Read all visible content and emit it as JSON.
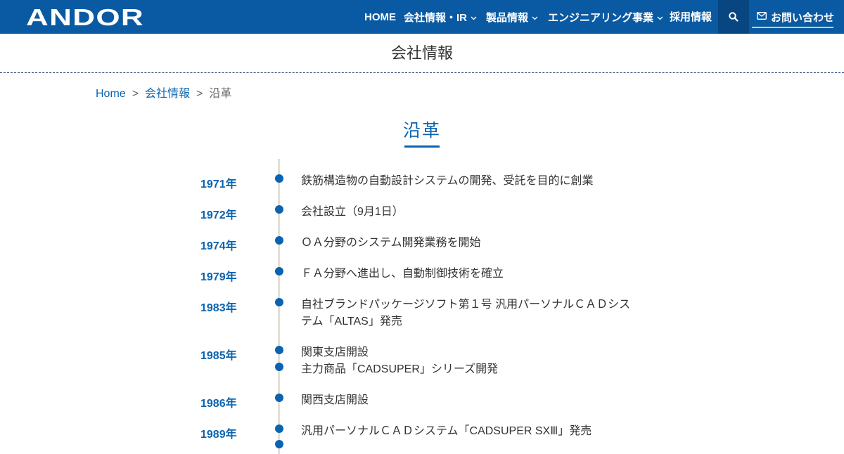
{
  "header": {
    "logo_text": "ANDOR",
    "nav": [
      {
        "label": "HOME",
        "has_dropdown": false
      },
      {
        "label": "会社情報・IR",
        "has_dropdown": true
      },
      {
        "label": "製品情報",
        "has_dropdown": true
      },
      {
        "label": "エンジニアリング事業",
        "has_dropdown": true
      },
      {
        "label": "採用情報",
        "has_dropdown": false
      }
    ],
    "search_icon": "search-icon",
    "contact_label": "お問い合わせ",
    "contact_icon": "mail-icon",
    "colors": {
      "bar": "#0a5aa3",
      "search_bg": "#074680",
      "accent_underline": "#e8d07a"
    }
  },
  "page_title": "会社情報",
  "breadcrumb": [
    {
      "label": "Home",
      "link": true
    },
    {
      "label": "会社情報",
      "link": true
    },
    {
      "label": "沿革",
      "link": false
    }
  ],
  "breadcrumb_separator": ">",
  "section_title": "沿革",
  "timeline": [
    {
      "year": "1971年",
      "events": [
        "鉄筋構造物の自動設計システムの開発、受託を目的に創業"
      ]
    },
    {
      "year": "1972年",
      "events": [
        "会社設立（9月1日）"
      ]
    },
    {
      "year": "1974年",
      "events": [
        "ＯＡ分野のシステム開発業務を開始"
      ]
    },
    {
      "year": "1979年",
      "events": [
        "ＦＡ分野へ進出し、自動制御技術を確立"
      ]
    },
    {
      "year": "1983年",
      "events": [
        "自社ブランドパッケージソフト第１号 汎用パーソナルＣＡＤシステム「ALTAS」発売"
      ]
    },
    {
      "year": "1985年",
      "events": [
        "関東支店開設",
        "主力商品「CADSUPER」シリーズ開発"
      ]
    },
    {
      "year": "1986年",
      "events": [
        "関西支店開設"
      ]
    },
    {
      "year": "1989年",
      "events": [
        "汎用パーソナルＣＡＤシステム「CADSUPER SXⅢ」発売"
      ]
    }
  ],
  "colors": {
    "primary": "#0a63b0",
    "timeline_line": "#e3e0d4",
    "text": "#333333"
  }
}
